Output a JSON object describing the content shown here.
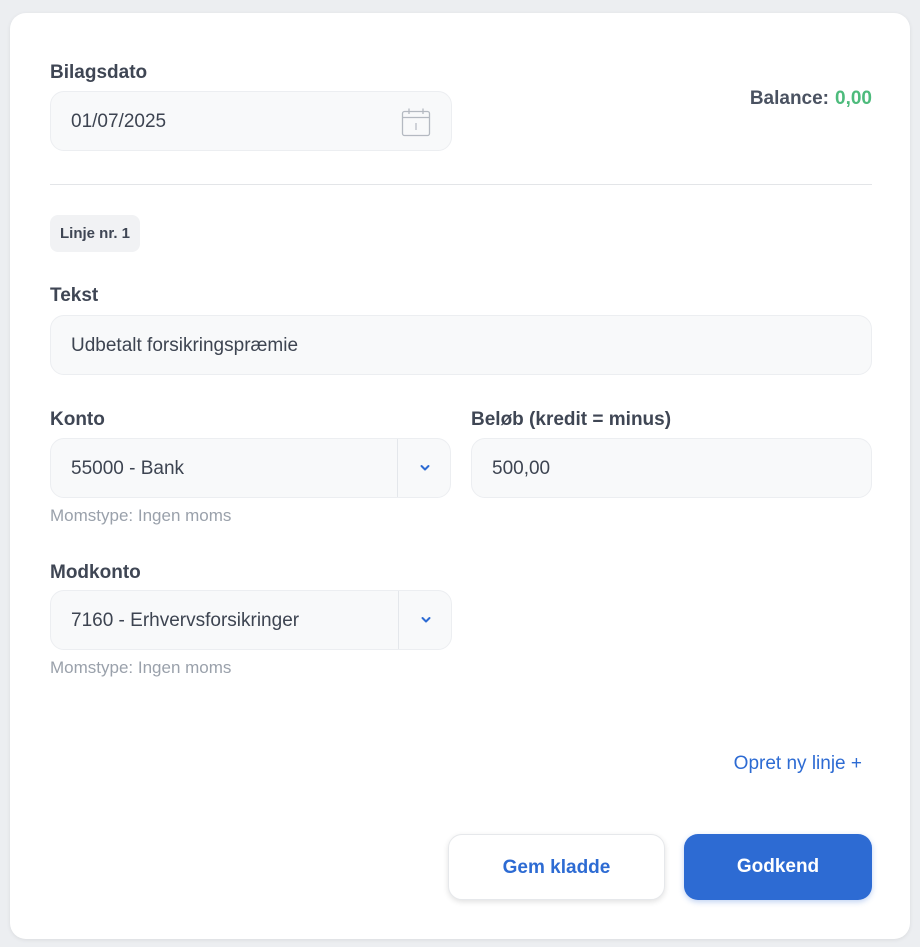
{
  "voucher_date": {
    "label": "Bilagsdato",
    "value": "01/07/2025",
    "icon": "calendar-icon"
  },
  "balance": {
    "label": "Balance:",
    "value": "0,00",
    "value_color": "#4dbb7c"
  },
  "line": {
    "badge": "Linje nr. 1",
    "text": {
      "label": "Tekst",
      "value": "Udbetalt forsikringspræmie"
    },
    "account": {
      "label": "Konto",
      "value": "55000 - Bank",
      "hint": "Momstype: Ingen moms"
    },
    "amount": {
      "label": "Beløb (kredit = minus)",
      "value": "500,00"
    },
    "counter_account": {
      "label": "Modkonto",
      "value": "7160 - Erhvervsforsikringer",
      "hint": "Momstype: Ingen moms"
    }
  },
  "actions": {
    "add_line": "Opret ny linje +",
    "save_draft": "Gem kladde",
    "approve": "Godkend",
    "accent_color": "#2d6bd3"
  }
}
